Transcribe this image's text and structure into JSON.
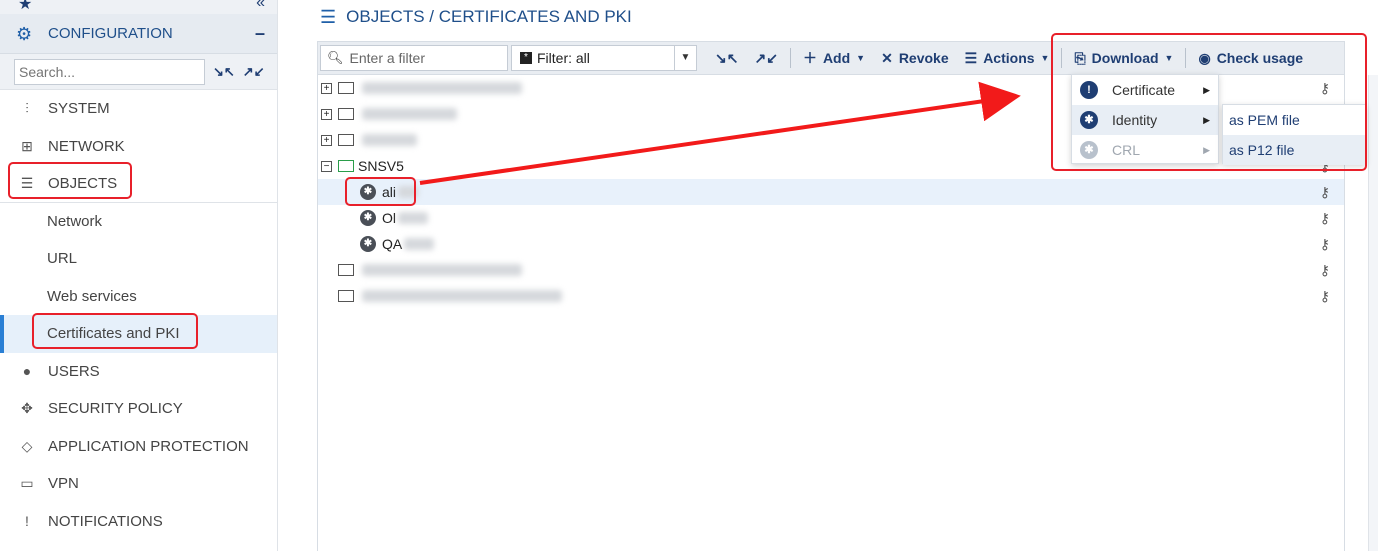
{
  "sidebar": {
    "config_title": "CONFIGURATION",
    "search_placeholder": "Search...",
    "items": [
      {
        "label": "SYSTEM",
        "icon": "sliders-icon"
      },
      {
        "label": "NETWORK",
        "icon": "network-icon"
      },
      {
        "label": "OBJECTS",
        "icon": "database-icon"
      }
    ],
    "sub_items": [
      {
        "label": "Network"
      },
      {
        "label": "URL"
      },
      {
        "label": "Web services"
      },
      {
        "label": "Certificates and PKI"
      }
    ],
    "items2": [
      {
        "label": "USERS",
        "icon": "user-icon"
      },
      {
        "label": "SECURITY POLICY",
        "icon": "arrows-icon"
      },
      {
        "label": "APPLICATION PROTECTION",
        "icon": "shield-icon"
      },
      {
        "label": "VPN",
        "icon": "vpn-icon"
      },
      {
        "label": "NOTIFICATIONS",
        "icon": "notification-icon"
      }
    ]
  },
  "main": {
    "title": "OBJECTS / CERTIFICATES AND PKI"
  },
  "toolbar": {
    "filter_placeholder": "Enter a filter",
    "filter_select": "Filter: all",
    "add_label": "Add",
    "revoke_label": "Revoke",
    "actions_label": "Actions",
    "download_label": "Download",
    "check_usage_label": "Check usage"
  },
  "tree": {
    "folder_name": "SNSV5",
    "certs": [
      "ali",
      "Ol",
      "QA"
    ]
  },
  "download_menu": {
    "items": [
      "Certificate",
      "Identity",
      "CRL"
    ],
    "identity_submenu": [
      "as PEM file",
      "as P12 file"
    ]
  },
  "colors": {
    "accent": "#1f3e73",
    "highlight": "#e8202a",
    "selection": "#e8f1fb"
  }
}
